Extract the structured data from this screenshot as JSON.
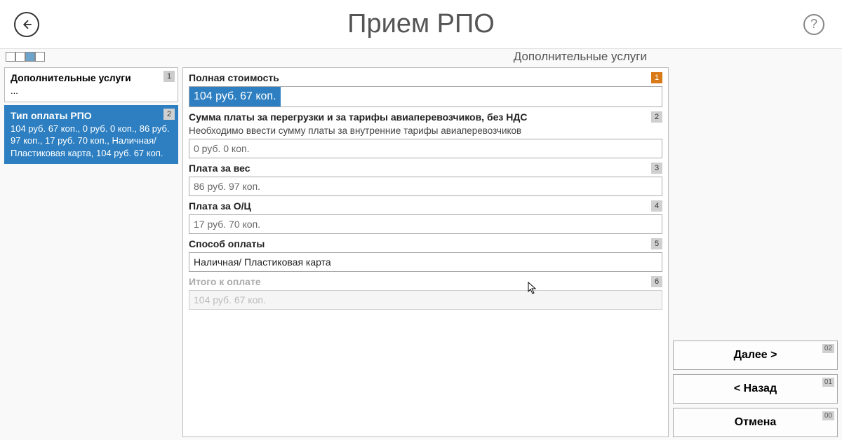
{
  "header": {
    "title": "Прием РПО"
  },
  "subheader": {
    "section": "Дополнительные услуги"
  },
  "sidebar": {
    "items": [
      {
        "title": "Дополнительные услуги",
        "body": "...",
        "num": "1"
      },
      {
        "title": "Тип оплаты РПО",
        "body": "104 руб. 67 коп., 0 руб. 0 коп., 86 руб. 97 коп., 17 руб. 70 коп., Наличная/ Пластиковая карта, 104 руб. 67 коп.",
        "num": "2"
      }
    ]
  },
  "fields": [
    {
      "label": "Полная стоимость",
      "value": "104 руб. 67 коп.",
      "num": "1",
      "highlight": true
    },
    {
      "label": "Сумма платы за перегрузки и за тарифы авиаперевозчиков, без НДС",
      "hint": "Необходимо ввести сумму платы за внутренние тарифы авиаперевозчиков",
      "value": "0 руб. 0 коп.",
      "num": "2"
    },
    {
      "label": "Плата за вес",
      "value": "86 руб. 97 коп.",
      "num": "3"
    },
    {
      "label": "Плата за О/Ц",
      "value": "17 руб. 70 коп.",
      "num": "4"
    },
    {
      "label": "Способ оплаты",
      "value": "Наличная/ Пластиковая карта",
      "num": "5"
    },
    {
      "label": "Итого к оплате",
      "value": "104 руб. 67 коп.",
      "num": "6",
      "disabled": true
    }
  ],
  "buttons": {
    "next": {
      "label": "Далее >",
      "kb": "02"
    },
    "back": {
      "label": "< Назад",
      "kb": "01"
    },
    "cancel": {
      "label": "Отмена",
      "kb": "00"
    }
  }
}
